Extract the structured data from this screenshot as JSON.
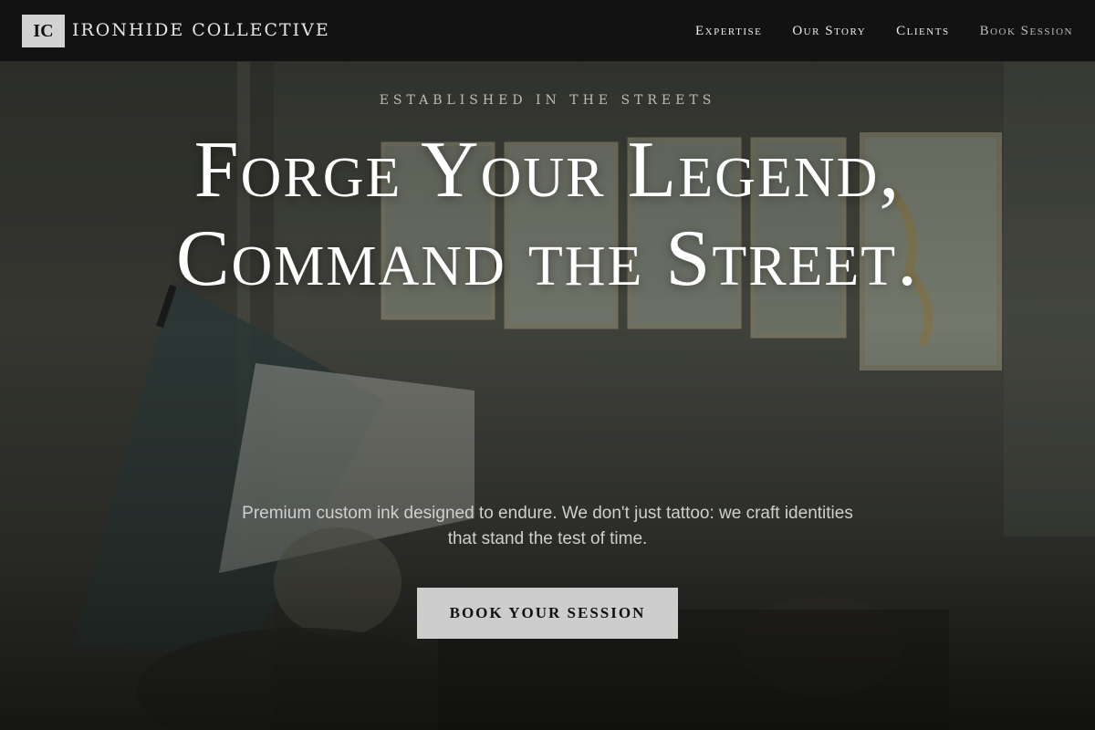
{
  "header": {
    "logo_badge": "IC",
    "brand_name": "IRONHIDE COLLECTIVE",
    "nav": [
      {
        "label": "Expertise"
      },
      {
        "label": "Our Story"
      },
      {
        "label": "Clients"
      },
      {
        "label": "Book Session"
      }
    ]
  },
  "hero": {
    "eyebrow": "ESTABLISHED IN THE STREETS",
    "headline": "Forge Your Legend, Command the Street.",
    "subtext": "Premium custom ink designed to endure. We don't just tattoo: we craft identities that stand the test of time.",
    "cta_label": "BOOK YOUR SESSION"
  },
  "colors": {
    "header_bg": "#121212",
    "cta_bg": "#cdcdcd",
    "headline": "#ffffff"
  }
}
